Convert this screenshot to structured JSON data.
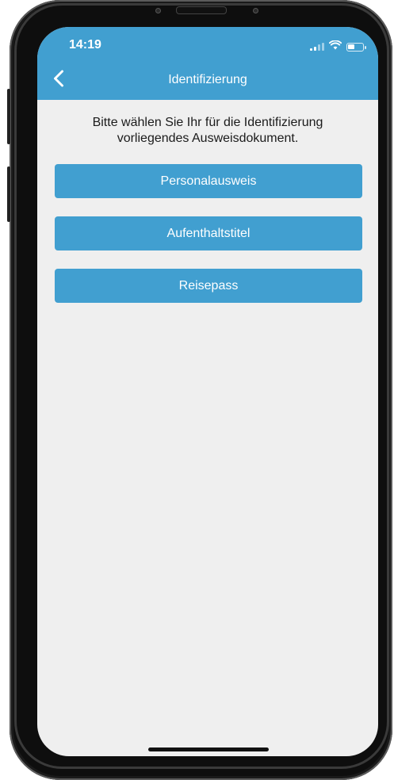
{
  "status_bar": {
    "time": "14:19",
    "icons": [
      "signal-icon",
      "wifi-icon",
      "battery-icon"
    ]
  },
  "nav": {
    "title": "Identifizierung",
    "back_icon": "chevron-left-icon"
  },
  "intro": {
    "line1": "Bitte wählen Sie Ihr für die Identifizierung",
    "line2": "vorliegendes Ausweisdokument."
  },
  "documents": [
    {
      "label": "Personalausweis"
    },
    {
      "label": "Aufenthaltstitel"
    },
    {
      "label": "Reisepass"
    }
  ],
  "colors": {
    "accent": "#419fd0",
    "background": "#efefef",
    "text": "#1b1b1b"
  }
}
